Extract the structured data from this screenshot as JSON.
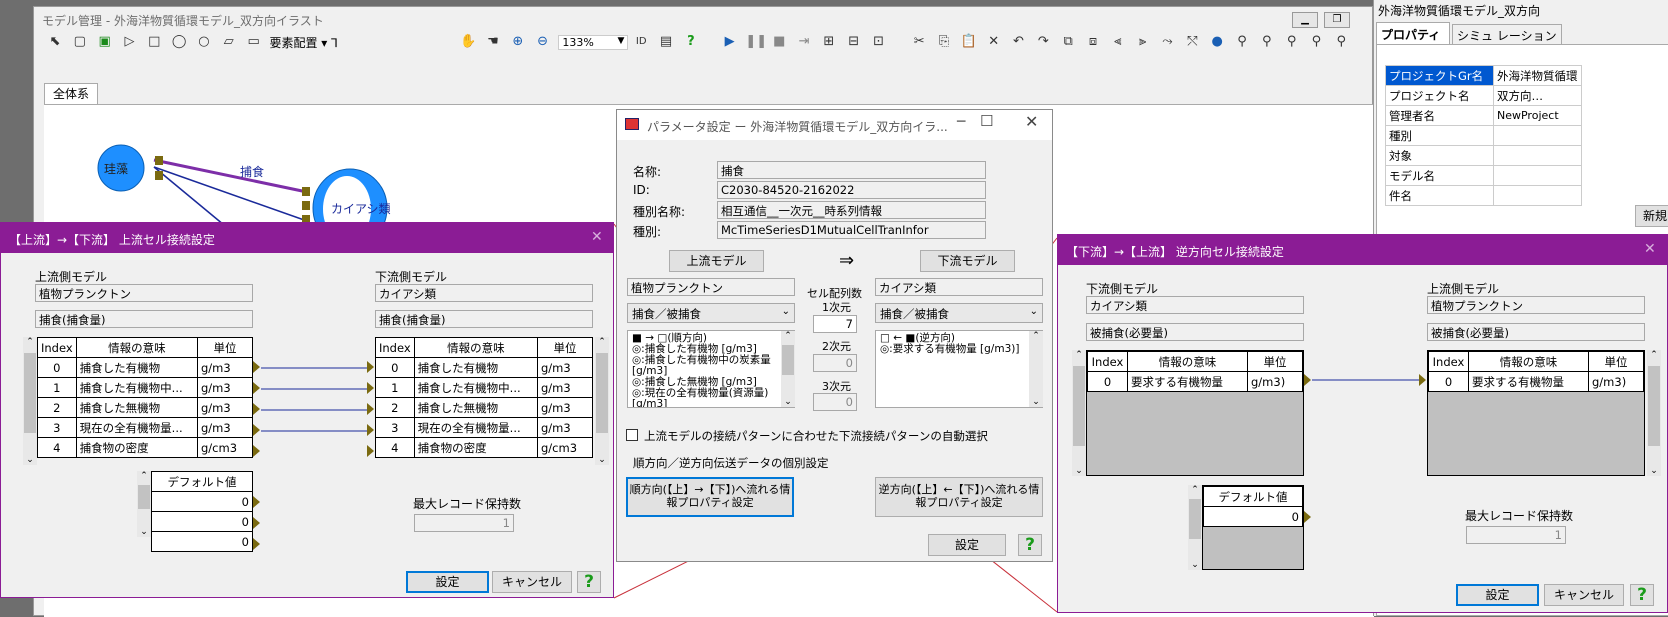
{
  "main": {
    "title": "モデル管理 - 外海洋物質循環モデル_双方向イラスト",
    "toolbar": {
      "layout_label": "要素配置",
      "zoom": "133%"
    },
    "tab": "全体系",
    "nodes": [
      {
        "label": "珪藻"
      },
      {
        "label": "カイアシ類"
      }
    ],
    "link_label": "捕食"
  },
  "props": {
    "title": "外海洋物質循環モデル_双方向",
    "tabs": [
      "プロパティ",
      "シミュ レーション"
    ],
    "rows": [
      {
        "k": "プロジェクトGr名",
        "v": "外海洋物質循環"
      },
      {
        "k": "プロジェクト名",
        "v": "双方向…"
      },
      {
        "k": "管理者名",
        "v": "NewProject"
      },
      {
        "k": "種別",
        "v": ""
      },
      {
        "k": "対象",
        "v": ""
      },
      {
        "k": "モデル名",
        "v": ""
      },
      {
        "k": "件名",
        "v": ""
      }
    ],
    "new_button": "新規"
  },
  "param": {
    "title": "パラメータ設定 ー 外海洋物質循環モデル_双方向イラ...",
    "labels": {
      "name": "名称:",
      "id": "ID:",
      "kind_name": "種別名称:",
      "kind": "種別:"
    },
    "values": {
      "name": "捕食",
      "id": "C2030-84520-2162022",
      "kind_name": "相互通信__一次元__時系列情報",
      "kind": "McTimeSeriesD1MutualCellTranInfor"
    },
    "upstream_button": "上流モデル",
    "downstream_button": "下流モデル",
    "arrow": "⇒",
    "up_model": "植物プランクトン",
    "down_model": "カイアシ類",
    "up_select": "捕食／被捕食",
    "down_select": "捕食／被捕食",
    "cell_label": "セル配列数",
    "dim1_label": "1次元",
    "dim1": "7",
    "dim2_label": "2次元",
    "dim2": "0",
    "dim3_label": "3次元",
    "dim3": "0",
    "up_list": [
      "■ → □(順方向)",
      "◎:捕食した有機物 [g/m3]",
      "◎:捕食した有機物中の炭素量 [g/m3]",
      "◎:捕食した無機物 [g/m3]",
      "◎:現在の全有機物量(資源量) [g/m3]"
    ],
    "down_list": [
      "□ ← ■(逆方向)",
      "◎:要求する有機物量 [g/m3)]"
    ],
    "auto_select": "上流モデルの接続パターンに合わせた下流接続パターンの自動選択",
    "section": "順方向／逆方向伝送データの個別設定",
    "forward_btn": "順方向(【上】→【下】)へ流れる情報プロパティ設定",
    "reverse_btn": "逆方向(【上】←【下】)へ流れる情報プロパティ設定",
    "set": "設定",
    "help": "?"
  },
  "up_dialog": {
    "title": "【上流】→【下流】 上流セル接続設定",
    "up_label": "上流側モデル",
    "down_label": "下流側モデル",
    "up_model": "植物プランクトン",
    "up_info": "捕食(捕食量)",
    "down_model": "カイアシ類",
    "down_info": "捕食(捕食量)",
    "headers": [
      "Index",
      "情報の意味",
      "単位"
    ],
    "rows": [
      {
        "i": "0",
        "m": "捕食した有機物",
        "u": "g/m3"
      },
      {
        "i": "1",
        "m": "捕食した有機物中...",
        "u": "g/m3"
      },
      {
        "i": "2",
        "m": "捕食した無機物",
        "u": "g/m3"
      },
      {
        "i": "3",
        "m": "現在の全有機物量...",
        "u": "g/m3"
      },
      {
        "i": "4",
        "m": "捕食物の密度",
        "u": "g/cm3"
      }
    ],
    "default_label": "デフォルト値",
    "defaults": [
      "0",
      "0",
      "0"
    ],
    "max_label": "最大レコード保持数",
    "max_value": "1",
    "set": "設定",
    "cancel": "キャンセル",
    "help": "?"
  },
  "down_dialog": {
    "title": "【下流】→【上流】 逆方向セル接続設定",
    "down_label": "下流側モデル",
    "up_label": "上流側モデル",
    "down_model": "カイアシ類",
    "down_info": "被捕食(必要量)",
    "up_model": "植物プランクトン",
    "up_info": "被捕食(必要量)",
    "headers": [
      "Index",
      "情報の意味",
      "単位"
    ],
    "row": {
      "i": "0",
      "m": "要求する有機物量",
      "u": "g/m3)"
    },
    "default_label": "デフォルト値",
    "default_value": "0",
    "max_label": "最大レコード保持数",
    "max_value": "1",
    "set": "設定",
    "cancel": "キャンセル",
    "help": "?"
  }
}
